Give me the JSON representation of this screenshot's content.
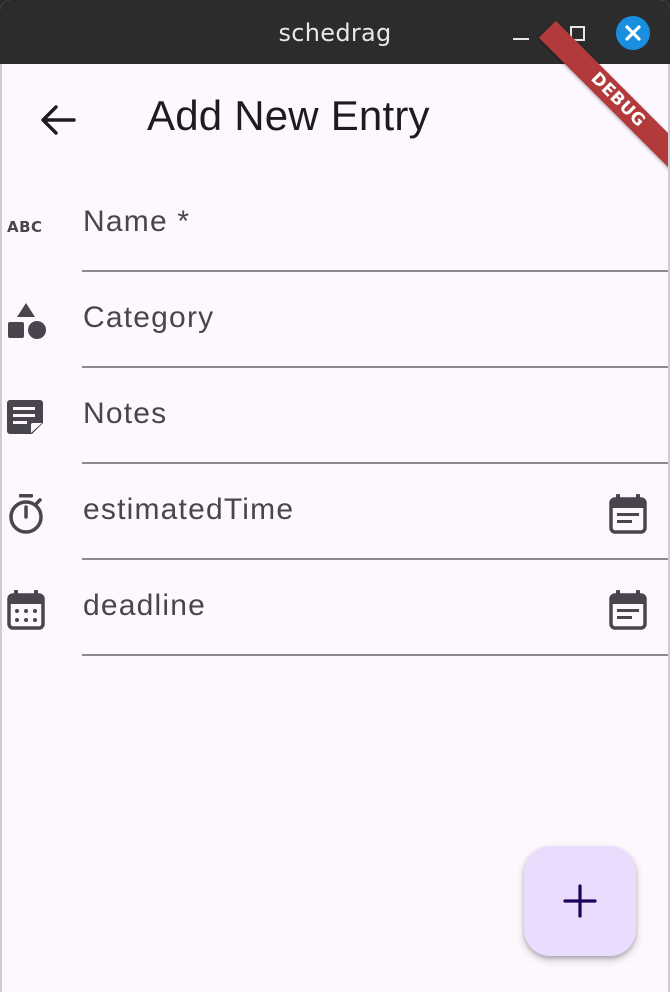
{
  "window": {
    "title": "schedrag"
  },
  "appbar": {
    "title": "Add New Entry",
    "back_icon": "arrow-back-icon"
  },
  "debug_banner": "DEBUG",
  "fields": [
    {
      "label": "Name *",
      "icon": "abc-icon"
    },
    {
      "label": "Category",
      "icon": "category-shapes-icon"
    },
    {
      "label": "Notes",
      "icon": "sticky-note-icon"
    },
    {
      "label": "estimatedTime",
      "icon": "timer-icon",
      "trailing_icon": "calendar-view-icon"
    },
    {
      "label": "deadline",
      "icon": "calendar-month-icon",
      "trailing_icon": "calendar-view-icon"
    }
  ],
  "fab": {
    "icon": "add-icon"
  },
  "colors": {
    "titlebar": "#2c2c2c",
    "background": "#fdf7fe",
    "close_button": "#1a8fe0",
    "fab": "#eadcfd",
    "debug_banner": "#b23a3a",
    "icon": "#49454f"
  }
}
